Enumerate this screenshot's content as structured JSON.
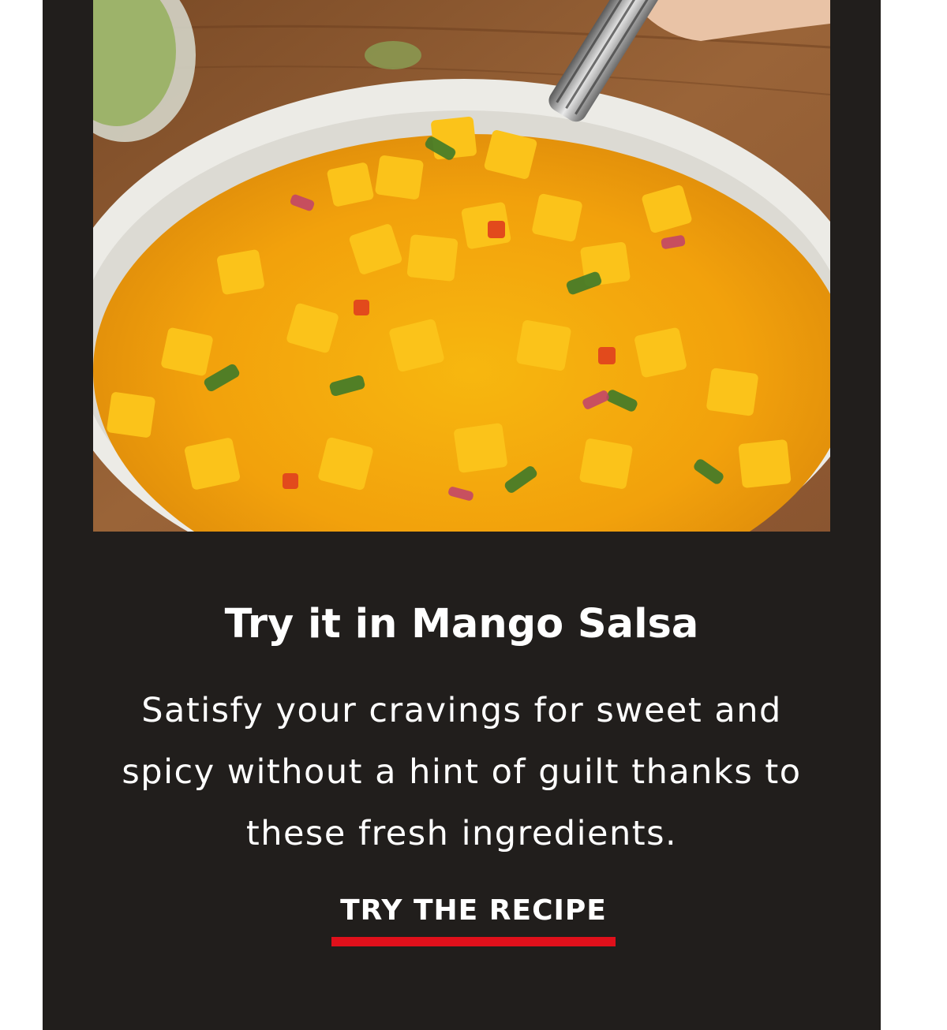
{
  "card": {
    "image_alt": "Mango salsa in a white bowl with a serving spoon",
    "title": "Try it in Mango Salsa",
    "description": "Satisfy your cravings for sweet and spicy without a hint of guilt thanks to these fresh ingredients.",
    "cta_label": "TRY THE RECIPE"
  },
  "colors": {
    "card_background": "#211e1c",
    "text": "#ffffff",
    "cta_underline": "#e0101b"
  }
}
